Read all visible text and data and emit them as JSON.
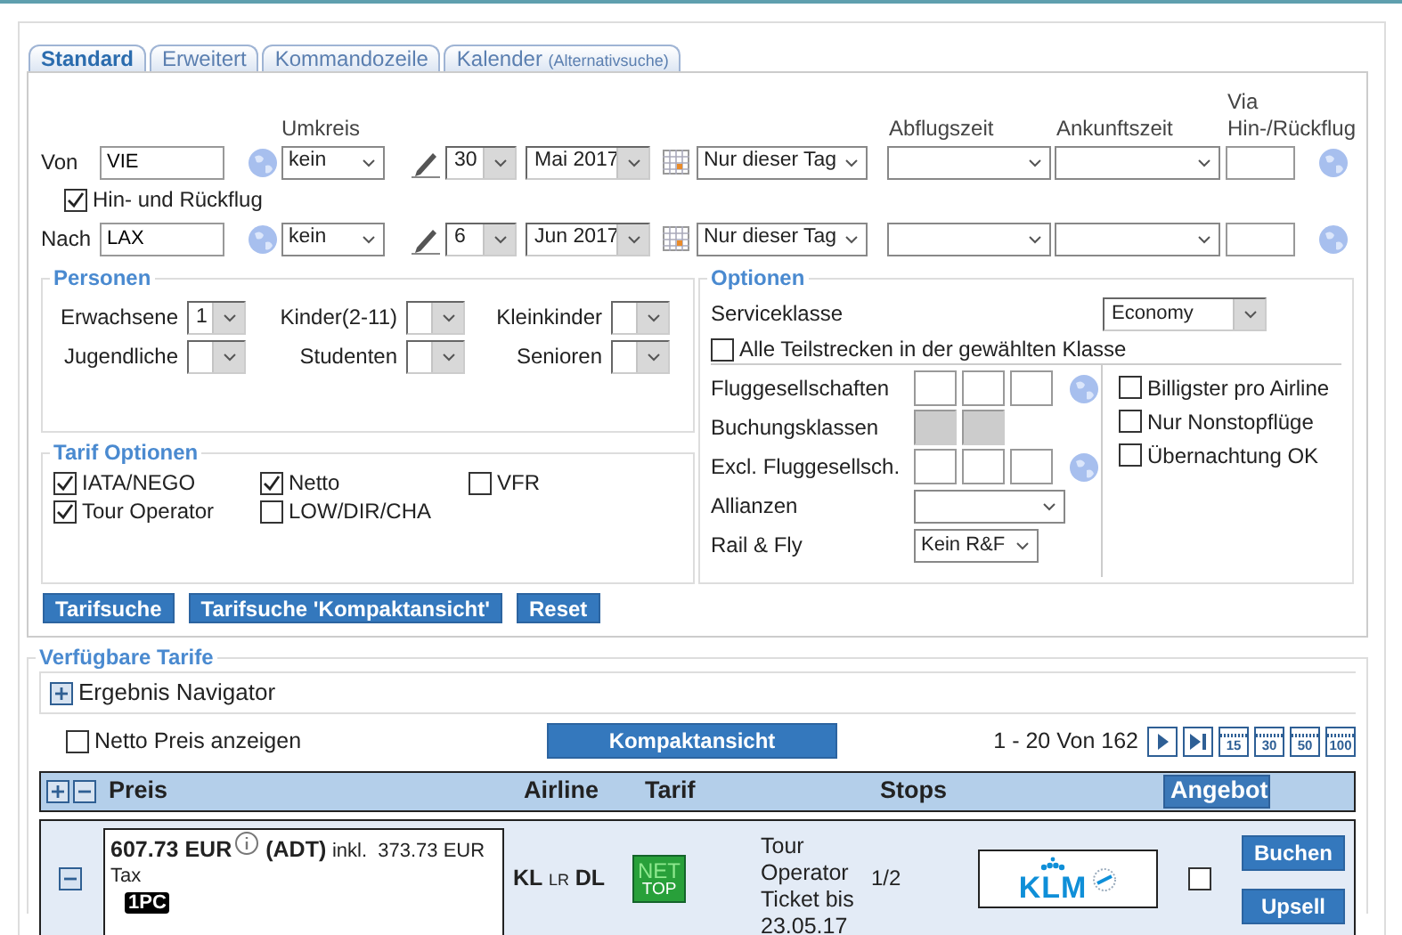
{
  "tabs": [
    {
      "label": "Standard",
      "selected": true
    },
    {
      "label": "Erweitert",
      "selected": false
    },
    {
      "label": "Kommandozeile",
      "selected": false
    },
    {
      "label": "Kalender",
      "note": "(Alternativsuche)",
      "selected": false
    }
  ],
  "search": {
    "column_headers": [
      {
        "kind": "radius",
        "label": "Umkreis"
      },
      {
        "kind": "departure",
        "label": "Abflugszeit"
      },
      {
        "kind": "arrival",
        "label": "Ankunftszeit"
      },
      {
        "kind": "via",
        "label": "Via Hin-/Rückflug"
      }
    ],
    "legs": [
      {
        "label": "Von",
        "airport": "VIE",
        "radius": "kein",
        "day": "30",
        "month": "Mai 2017",
        "date_range": "Nur dieser Tag"
      },
      {
        "label": "Nach",
        "airport": "LAX",
        "radius": "kein",
        "day": "6",
        "month": "Jun 2017",
        "date_range": "Nur dieser Tag"
      }
    ],
    "round_trip": {
      "label": "Hin- und Rückflug",
      "checked": true
    }
  },
  "persons": {
    "title": "Personen",
    "fields": [
      {
        "label": "Erwachsene",
        "value": "1"
      },
      {
        "label": "Kinder(2-11)"
      },
      {
        "label": "Kleinkinder"
      },
      {
        "label": "Jugendliche"
      },
      {
        "label": "Studenten"
      },
      {
        "label": "Senioren"
      }
    ]
  },
  "fare_options": {
    "title": "Tarif Optionen",
    "items": [
      {
        "label": "IATA/NEGO",
        "checked": true
      },
      {
        "label": "Netto",
        "checked": true
      },
      {
        "label": "VFR",
        "checked": false
      },
      {
        "label": "Tour Operator",
        "checked": true
      },
      {
        "label": "LOW/DIR/CHA",
        "checked": false
      }
    ]
  },
  "form_buttons": [
    "Tarifsuche",
    "Tarifsuche 'Kompaktansicht'",
    "Reset"
  ],
  "options": {
    "title": "Optionen",
    "service_class": {
      "label": "Serviceklasse",
      "value": "Economy"
    },
    "all_segments": {
      "label": "Alle Teilstrecken in der gewählten Klasse",
      "checked": false
    },
    "fields": [
      {
        "kind": "airline-codes",
        "label": "Fluggesellschaften"
      },
      {
        "kind": "class-codes",
        "label": "Buchungsklassen"
      },
      {
        "kind": "airline-codes",
        "label": "Excl. Fluggesellsch."
      },
      {
        "kind": "select",
        "label": "Allianzen"
      },
      {
        "kind": "short-select",
        "label": "Rail & Fly",
        "value": "Kein R&F"
      }
    ],
    "flags": [
      {
        "label": "Billigster pro Airline",
        "checked": false
      },
      {
        "label": "Nur Nonstopflüge",
        "checked": false
      },
      {
        "label": "Übernachtung OK",
        "checked": false
      }
    ]
  },
  "results": {
    "title": "Verfügbare Tarife",
    "navigator": {
      "label": "Ergebnis Navigator",
      "expanded": false
    },
    "net_price": {
      "label": "Netto Preis anzeigen",
      "checked": false
    },
    "compact_button": "Kompaktansicht",
    "range": "1 - 20 Von 162",
    "page_sizes": [
      "15",
      "30",
      "50",
      "100"
    ],
    "columns": [
      {
        "kind": "price",
        "label": "Preis"
      },
      {
        "kind": "airline",
        "label": "Airline"
      },
      {
        "kind": "fare",
        "label": "Tarif"
      },
      {
        "kind": "stops",
        "label": "Stops"
      },
      {
        "kind": "offer",
        "label": "Angebot"
      }
    ],
    "rows": [
      {
        "expanded": true,
        "price": "607.73 EUR",
        "pax": "(ADT)",
        "tax": "inkl.  373.73 EUR",
        "tax_label": "Tax",
        "baggage": "1PC",
        "airlines": [
          {
            "code": "KL",
            "kind": "main"
          },
          {
            "code": "LR",
            "kind": "partner"
          },
          {
            "code": "DL",
            "kind": "main"
          }
        ],
        "fare_badge": {
          "top": "NET",
          "bottom": "TOP"
        },
        "fare_info": "Tour Operator Ticket bis 23.05.17",
        "stops": "1/2",
        "logo": "KLM",
        "checked": false,
        "actions": [
          "Buchen",
          "Upsell"
        ]
      }
    ]
  }
}
